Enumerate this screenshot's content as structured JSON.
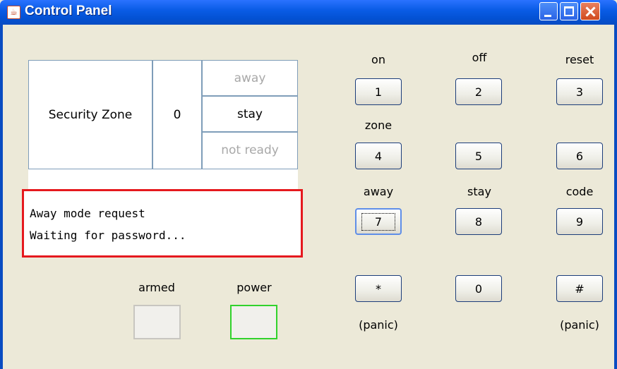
{
  "window": {
    "title": "Control Panel"
  },
  "zone": {
    "name": "Security Zone",
    "number": "0",
    "states": {
      "away": "away",
      "stay": "stay",
      "not_ready": "not ready"
    }
  },
  "message": {
    "line1": "Away mode request",
    "line2": "Waiting for password..."
  },
  "indicators": {
    "armed": "armed",
    "power": "power",
    "armed_color": "#c8c6c0",
    "power_color": "#31d22c"
  },
  "keypad": {
    "labels": {
      "on": "on",
      "off": "off",
      "reset": "reset",
      "zone": "zone",
      "away": "away",
      "stay": "stay",
      "code": "code",
      "panic_left": "(panic)",
      "panic_right": "(panic)"
    },
    "keys": {
      "k1": "1",
      "k2": "2",
      "k3": "3",
      "k4": "4",
      "k5": "5",
      "k6": "6",
      "k7": "7",
      "k8": "8",
      "k9": "9",
      "kstar": "*",
      "k0": "0",
      "khash": "#"
    }
  },
  "colors": {
    "titlebar": "#0351d3",
    "message_border": "#e5191e",
    "background": "#ece9d8"
  }
}
